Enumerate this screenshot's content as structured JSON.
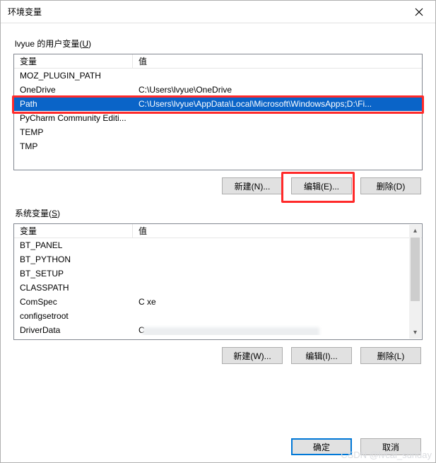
{
  "title": "环境变量",
  "watermark": "CSDN @lvcal_sunday",
  "user_section": {
    "label_prefix": "lvyue 的用户变量(",
    "label_accesskey": "U",
    "label_suffix": ")",
    "header_name": "变量",
    "header_value": "值",
    "rows": [
      {
        "name": "MOZ_PLUGIN_PATH",
        "value": "",
        "blurred": true,
        "blur_width": 300
      },
      {
        "name": "OneDrive",
        "value": "C:\\Users\\lvyue\\OneDrive",
        "blurred": false
      },
      {
        "name": "Path",
        "value": "C:\\Users\\lvyue\\AppData\\Local\\Microsoft\\WindowsApps;D:\\Fi...",
        "blurred": false,
        "selected": true
      },
      {
        "name": "PyCharm Community Editi...",
        "value": "",
        "blurred": true,
        "blur_width": 210
      },
      {
        "name": "TEMP",
        "value": "",
        "blurred": true,
        "blur_width": 260
      },
      {
        "name": "TMP",
        "value": "",
        "blurred": true,
        "blur_width": 260
      }
    ],
    "btn_new": "新建(N)...",
    "btn_edit": "编辑(E)...",
    "btn_del": "删除(D)"
  },
  "sys_section": {
    "label_prefix": "系统变量(",
    "label_accesskey": "S",
    "label_suffix": ")",
    "header_name": "变量",
    "header_value": "值",
    "rows": [
      {
        "name": "BT_PANEL",
        "value": "",
        "blurred": true,
        "blur_width": 80,
        "blur_extra": 0
      },
      {
        "name": "BT_PYTHON",
        "value": "",
        "blurred": true,
        "blur_width": 140,
        "blur_extra": 0
      },
      {
        "name": "BT_SETUP",
        "value": "",
        "blurred": true,
        "blur_width": 50,
        "blur_extra": 0
      },
      {
        "name": "CLASSPATH",
        "value": "",
        "blurred": true,
        "blur_width": 200,
        "blur_extra": 150
      },
      {
        "name": "ComSpec",
        "value": "C                                              xe",
        "blurred": false
      },
      {
        "name": "configsetroot",
        "value": "",
        "blurred": true,
        "blur_width": 170,
        "blur_extra": 0
      },
      {
        "name": "DriverData",
        "value": "C",
        "blurred": true,
        "blur_width": 250,
        "blur_extra": 0,
        "prefix_visible": true
      }
    ],
    "btn_new": "新建(W)...",
    "btn_edit": "编辑(I)...",
    "btn_del": "删除(L)"
  },
  "footer": {
    "ok": "确定",
    "cancel": "取消"
  }
}
